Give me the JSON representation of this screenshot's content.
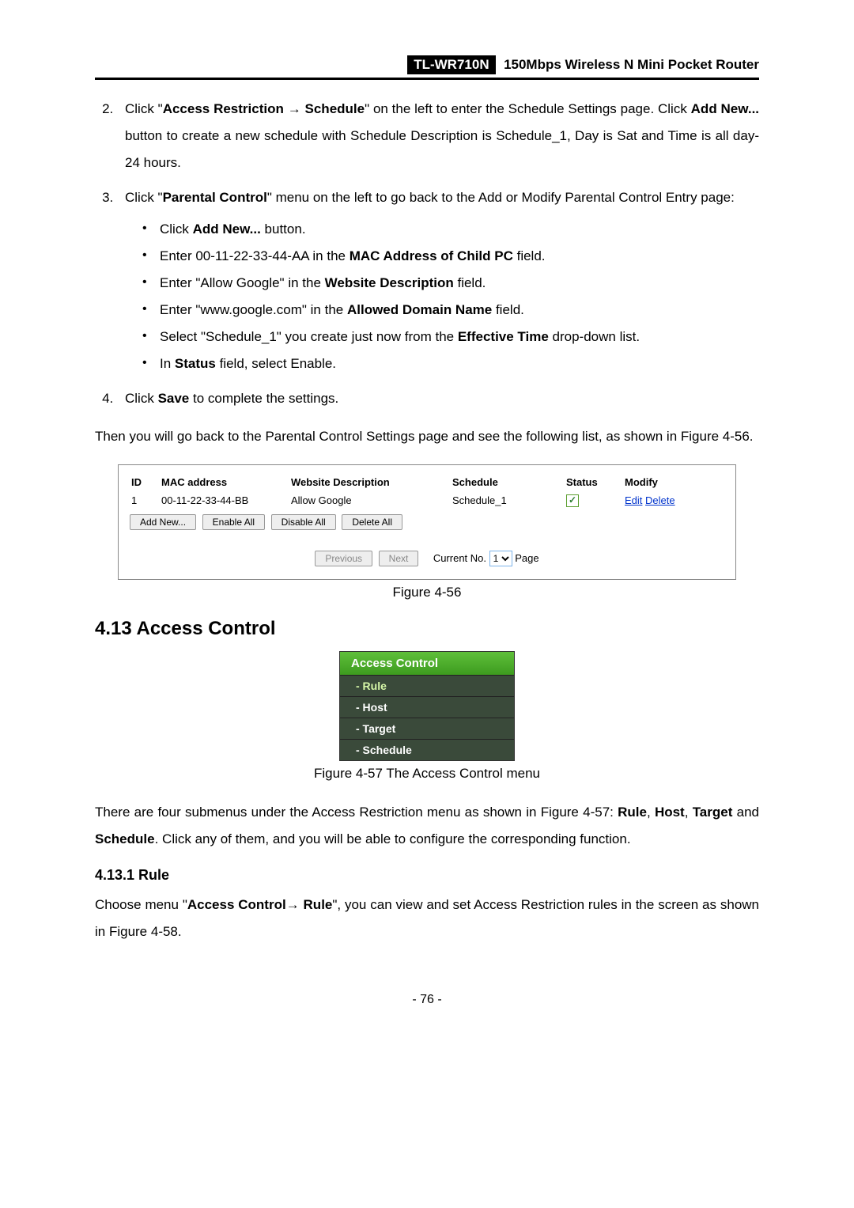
{
  "header": {
    "model": "TL-WR710N",
    "subtitle": "150Mbps Wireless N Mini Pocket Router"
  },
  "steps": {
    "s2": {
      "prefix": "Click \"",
      "b1": "Access Restriction → Schedule",
      "mid1": "\" on the left to enter the Schedule Settings page. Click ",
      "b2": "Add New...",
      "mid2": " button to create a new schedule with Schedule Description is Schedule_1, Day is Sat and Time is all day-24 hours."
    },
    "s3": {
      "prefix": "Click \"",
      "b1": "Parental Control",
      "mid1": "\" menu on the left to go back to the Add or Modify Parental Control Entry page:",
      "bullets": {
        "b1_pre": "Click ",
        "b1_bold": "Add New...",
        "b1_post": " button.",
        "b2_pre": "Enter 00-11-22-33-44-AA in the ",
        "b2_bold": "MAC Address of Child PC",
        "b2_post": " field.",
        "b3_pre": "Enter \"Allow Google\" in the ",
        "b3_bold": "Website Description",
        "b3_post": " field.",
        "b4_pre": "Enter \"www.google.com\" in the ",
        "b4_bold": "Allowed Domain Name",
        "b4_post": " field.",
        "b5_pre": "Select \"Schedule_1\" you create just now from the ",
        "b5_bold": "Effective Time",
        "b5_post": " drop-down list.",
        "b6_pre": "In ",
        "b6_bold": "Status",
        "b6_post": " field, select Enable."
      }
    },
    "s4": {
      "pre": "Click ",
      "bold": "Save",
      "post": " to complete the settings."
    }
  },
  "para1": "Then you will go back to the Parental Control Settings page and see the following list, as shown in Figure 4-56.",
  "fig56": {
    "headers": {
      "id": "ID",
      "mac": "MAC address",
      "desc": "Website Description",
      "sched": "Schedule",
      "status": "Status",
      "modify": "Modify"
    },
    "row": {
      "id": "1",
      "mac": "00-11-22-33-44-BB",
      "desc": "Allow Google",
      "sched": "Schedule_1",
      "edit": "Edit",
      "delete": "Delete"
    },
    "buttons": {
      "add": "Add New...",
      "enable": "Enable All",
      "disable": "Disable All",
      "delete": "Delete All",
      "prev": "Previous",
      "next": "Next"
    },
    "nav": {
      "label": "Current No.",
      "page": "Page",
      "value": "1"
    },
    "caption": "Figure 4-56",
    "check": "✓"
  },
  "section413": {
    "title": "4.13  Access Control"
  },
  "menu": {
    "title": "Access Control",
    "items": [
      "- Rule",
      "- Host",
      "- Target",
      "- Schedule"
    ]
  },
  "fig57caption": "Figure 4-57    The Access Control menu",
  "para2": {
    "pre": "There are four submenus under the Access Restriction menu as shown in Figure 4-57: ",
    "b1": "Rule",
    "mid1": ", ",
    "b2": "Host",
    "mid2": ", ",
    "b3": "Target",
    "mid3": " and ",
    "b4": "Schedule",
    "post": ". Click any of them, and you will be able to configure the corresponding function."
  },
  "section4131": {
    "title": "4.13.1 Rule"
  },
  "para3": {
    "pre": "Choose menu \"",
    "b1": "Access Control→ Rule",
    "post": "\", you can view and set Access Restriction rules in the screen as shown in Figure 4-58."
  },
  "pagenum": "- 76 -"
}
